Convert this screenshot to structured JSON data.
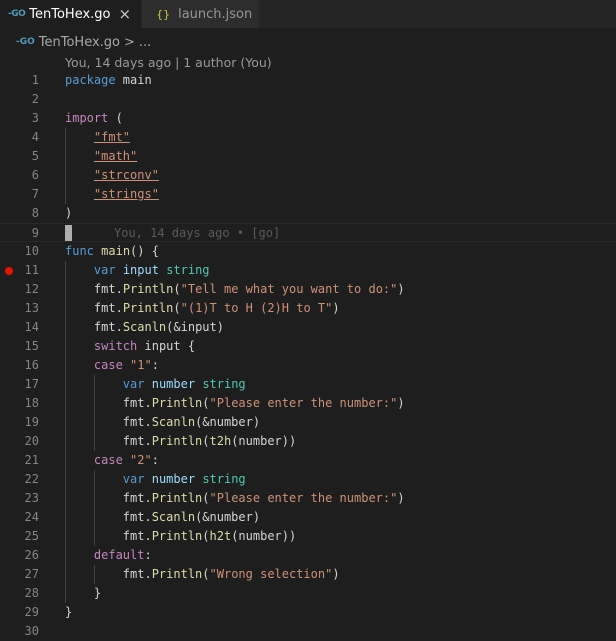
{
  "tabs": [
    {
      "icon": "go-icon",
      "icon_text": "-GO",
      "label": "TenToHex.go",
      "active": true
    },
    {
      "icon": "json-icon",
      "icon_text": "{}",
      "label": "launch.json",
      "active": false
    }
  ],
  "breadcrumb": {
    "icon_text": "-GO",
    "file": "TenToHex.go",
    "separator": ">",
    "rest": "..."
  },
  "codelens": "You, 14 days ago | 1 author (You)",
  "blame": "You, 14 days ago • [go]",
  "lines": [
    {
      "n": "1"
    },
    {
      "n": "2"
    },
    {
      "n": "3"
    },
    {
      "n": "4"
    },
    {
      "n": "5"
    },
    {
      "n": "6"
    },
    {
      "n": "7"
    },
    {
      "n": "8"
    },
    {
      "n": "9"
    },
    {
      "n": "10"
    },
    {
      "n": "11"
    },
    {
      "n": "12"
    },
    {
      "n": "13"
    },
    {
      "n": "14"
    },
    {
      "n": "15"
    },
    {
      "n": "16"
    },
    {
      "n": "17"
    },
    {
      "n": "18"
    },
    {
      "n": "19"
    },
    {
      "n": "20"
    },
    {
      "n": "21"
    },
    {
      "n": "22"
    },
    {
      "n": "23"
    },
    {
      "n": "24"
    },
    {
      "n": "25"
    },
    {
      "n": "26"
    },
    {
      "n": "27"
    },
    {
      "n": "28"
    },
    {
      "n": "29"
    },
    {
      "n": "30"
    }
  ],
  "code": {
    "package": "package",
    "main_pkg": " main",
    "import": "import",
    "open_paren": " (",
    "imp_fmt": "\"fmt\"",
    "imp_math": "\"math\"",
    "imp_strconv": "\"strconv\"",
    "imp_strings": "\"strings\"",
    "close_paren": ")",
    "func": "func",
    "main_fn": "main",
    "main_sig": "() {",
    "var": "var",
    "input": "input",
    "string": "string",
    "fmt": "fmt.",
    "println": "Println",
    "scanln": "Scanln",
    "s_tell": "\"Tell me what you want to do:\"",
    "s_opts": "\"(1)T to H (2)H to T\"",
    "amp_input": "(&input)",
    "switch": "switch",
    "switch_rest": " input {",
    "case": "case",
    "c1": "\"1\"",
    "c2": "\"2\"",
    "colon": ":",
    "number": "number",
    "s_enter": "\"Please enter the number:\"",
    "amp_number": "(&number)",
    "t2h": "t2h",
    "h2t": "h2t",
    "arg_number": "(number))",
    "default": "default",
    "s_wrong": "\"Wrong selection\"",
    "rbrace": "}",
    "lp": "(",
    "rp": ")"
  },
  "colors": {
    "breakpoint": "#e51400",
    "background": "#1e1e1e"
  }
}
